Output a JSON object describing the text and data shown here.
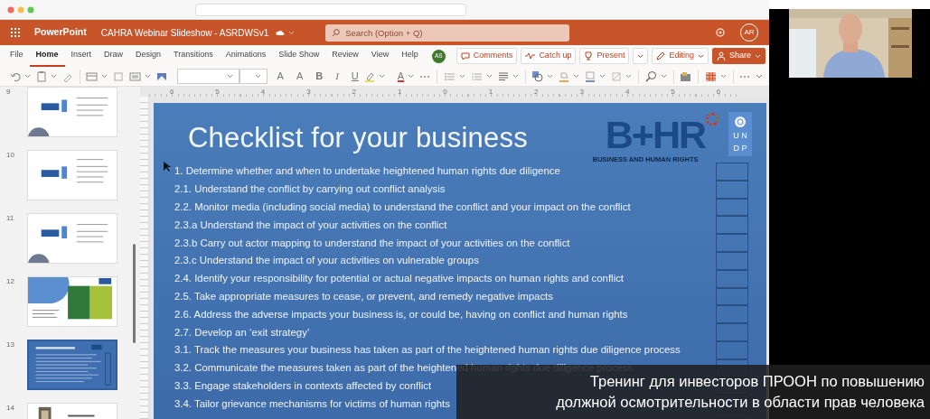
{
  "app_bar": {
    "app_name": "PowerPoint",
    "document_title": "CAHRA Webinar Slideshow - ASRDWSv1",
    "search": {
      "placeholder": "Search (Option + Q)"
    },
    "avatar": "AR"
  },
  "tabs": [
    {
      "label": "File",
      "selected": false
    },
    {
      "label": "Home",
      "selected": true
    },
    {
      "label": "Insert",
      "selected": false
    },
    {
      "label": "Draw",
      "selected": false
    },
    {
      "label": "Design",
      "selected": false
    },
    {
      "label": "Transitions",
      "selected": false
    },
    {
      "label": "Animations",
      "selected": false
    },
    {
      "label": "Slide Show",
      "selected": false
    },
    {
      "label": "Review",
      "selected": false
    },
    {
      "label": "View",
      "selected": false
    },
    {
      "label": "Help",
      "selected": false
    }
  ],
  "ribbon_actions": [
    {
      "kind": "avatar",
      "label": "AS"
    },
    {
      "kind": "comment",
      "label": "Comments"
    },
    {
      "kind": "activity",
      "label": "Catch up"
    },
    {
      "kind": "present",
      "label": "Present"
    },
    {
      "kind": "edit",
      "label": "Editing"
    },
    {
      "kind": "share",
      "label": "Share"
    }
  ],
  "toolbar": {
    "text_buttons": [
      {
        "kind": "grow",
        "label": "A"
      },
      {
        "kind": "shrink",
        "label": "A"
      },
      {
        "kind": "bold",
        "label": "B"
      },
      {
        "kind": "italic",
        "label": "I"
      },
      {
        "kind": "underline",
        "label": "U"
      },
      {
        "kind": "color",
        "label": "A"
      }
    ]
  },
  "ruler": {
    "labels": [
      "6",
      "5",
      "4",
      "3",
      "2",
      "1",
      "0",
      "1",
      "2",
      "3",
      "4",
      "5",
      "6"
    ]
  },
  "thumbnails": [
    {
      "number": "9",
      "kind": "text",
      "selected": false
    },
    {
      "number": "10",
      "kind": "plain",
      "selected": false
    },
    {
      "number": "11",
      "kind": "text",
      "selected": false
    },
    {
      "number": "12",
      "kind": "split",
      "selected": false
    },
    {
      "number": "13",
      "kind": "checklist",
      "selected": true
    },
    {
      "number": "14",
      "selected": false
    }
  ],
  "slide": {
    "title": "Checklist for your business",
    "logo": {
      "name": "B+HR",
      "tagline": "BUSINESS AND HUMAN RIGHTS",
      "undp": [
        "U N",
        "D P"
      ]
    },
    "items": [
      {
        "text": "1. Determine whether and when to undertake heightened human rights due diligence",
        "checked": false
      },
      {
        "text": "2.1. Understand the conflict by carrying out conflict analysis",
        "checked": false
      },
      {
        "text": "2.2. Monitor media (including social media) to understand the conflict and your impact on the conflict",
        "checked": false
      },
      {
        "text": "2.3.a Understand the impact of your activities on the conflict",
        "checked": false
      },
      {
        "text": "2.3.b Carry out actor mapping to understand the impact of your activities on the conflict",
        "checked": false
      },
      {
        "text": "2.3.c Understand the impact of your activities on vulnerable groups",
        "checked": false
      },
      {
        "text": "2.4. Identify your responsibility for potential or actual negative impacts on human rights and conflict",
        "checked": false
      },
      {
        "text": "2.5. Take appropriate measures to cease, or prevent, and remedy negative impacts",
        "checked": false
      },
      {
        "text": "2.6. Address the adverse impacts your business is, or could be, having on conflict and human rights",
        "checked": false
      },
      {
        "text": "2.7. Develop an ‘exit strategy’",
        "checked": false
      },
      {
        "text": "3.1. Track the measures your business has taken as part of the heightened human rights due diligence process",
        "checked": false
      },
      {
        "text": "3.2. Communicate the measures taken as part of the heightened human rights due diligence process",
        "checked": false
      },
      {
        "text": "3.3. Engage stakeholders in contexts affected by conflict",
        "checked": false
      },
      {
        "text": "3.4. Tailor grievance mechanisms for victims of human rights",
        "checked": false
      }
    ]
  },
  "subtitle": [
    "Тренинг для инвесторов ПРООН по повышению",
    "должной осмотрительности в области прав человека"
  ]
}
